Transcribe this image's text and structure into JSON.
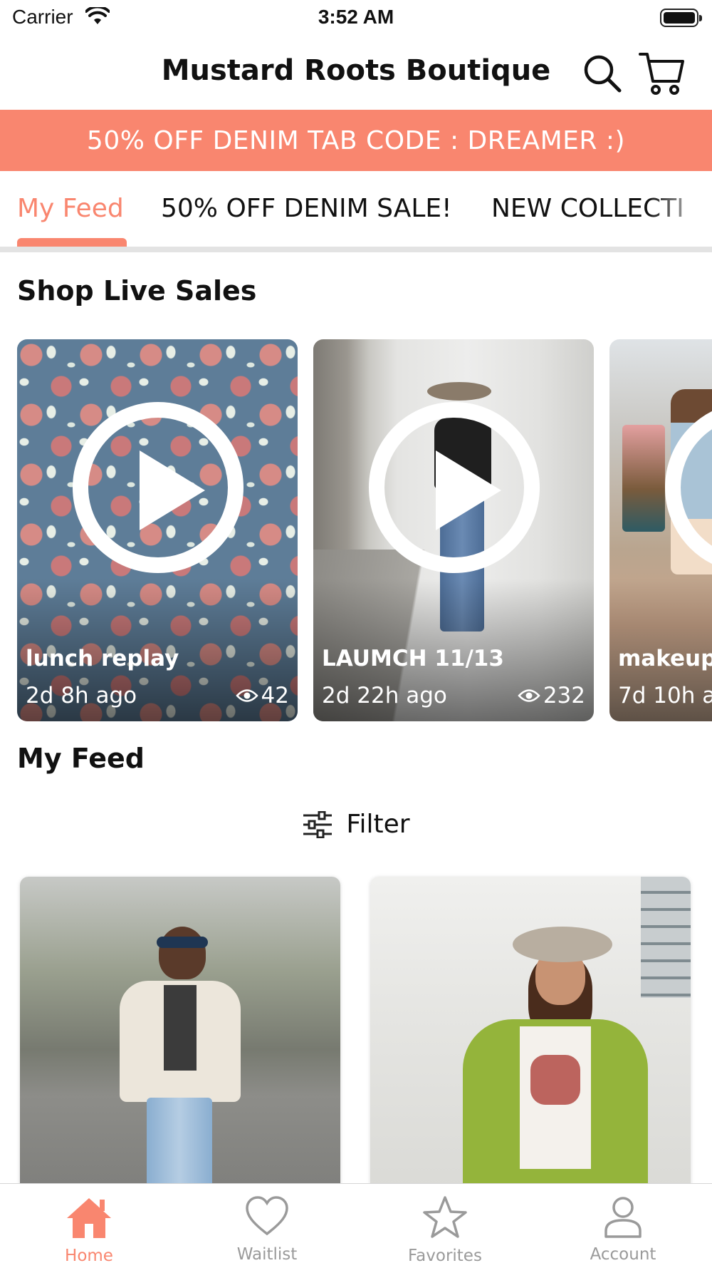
{
  "status_bar": {
    "carrier": "Carrier",
    "time": "3:52 AM"
  },
  "header": {
    "title": "Mustard Roots Boutique"
  },
  "promo_banner": {
    "text": "50% OFF DENIM TAB CODE : DREAMER :)"
  },
  "category_tabs": [
    {
      "label": "My Feed",
      "active": true
    },
    {
      "label": "50% OFF DENIM SALE!",
      "active": false
    },
    {
      "label": "NEW COLLECTI",
      "active": false
    }
  ],
  "live_sales": {
    "title": "Shop Live Sales",
    "items": [
      {
        "name": "lunch replay",
        "ago": "2d 8h ago",
        "views": "42"
      },
      {
        "name": "LAUMCH 11/13",
        "ago": "2d 22h ago",
        "views": "232"
      },
      {
        "name": "makeup",
        "ago": "7d 10h a",
        "views": ""
      }
    ]
  },
  "feed": {
    "title": "My Feed",
    "filter_label": "Filter"
  },
  "bottom_nav": [
    {
      "label": "Home",
      "icon": "home-icon",
      "active": true
    },
    {
      "label": "Waitlist",
      "icon": "heart-icon",
      "active": false
    },
    {
      "label": "Favorites",
      "icon": "star-icon",
      "active": false
    },
    {
      "label": "Account",
      "icon": "person-icon",
      "active": false
    }
  ],
  "colors": {
    "accent": "#f9866f",
    "inactive": "#9a9a9a"
  }
}
